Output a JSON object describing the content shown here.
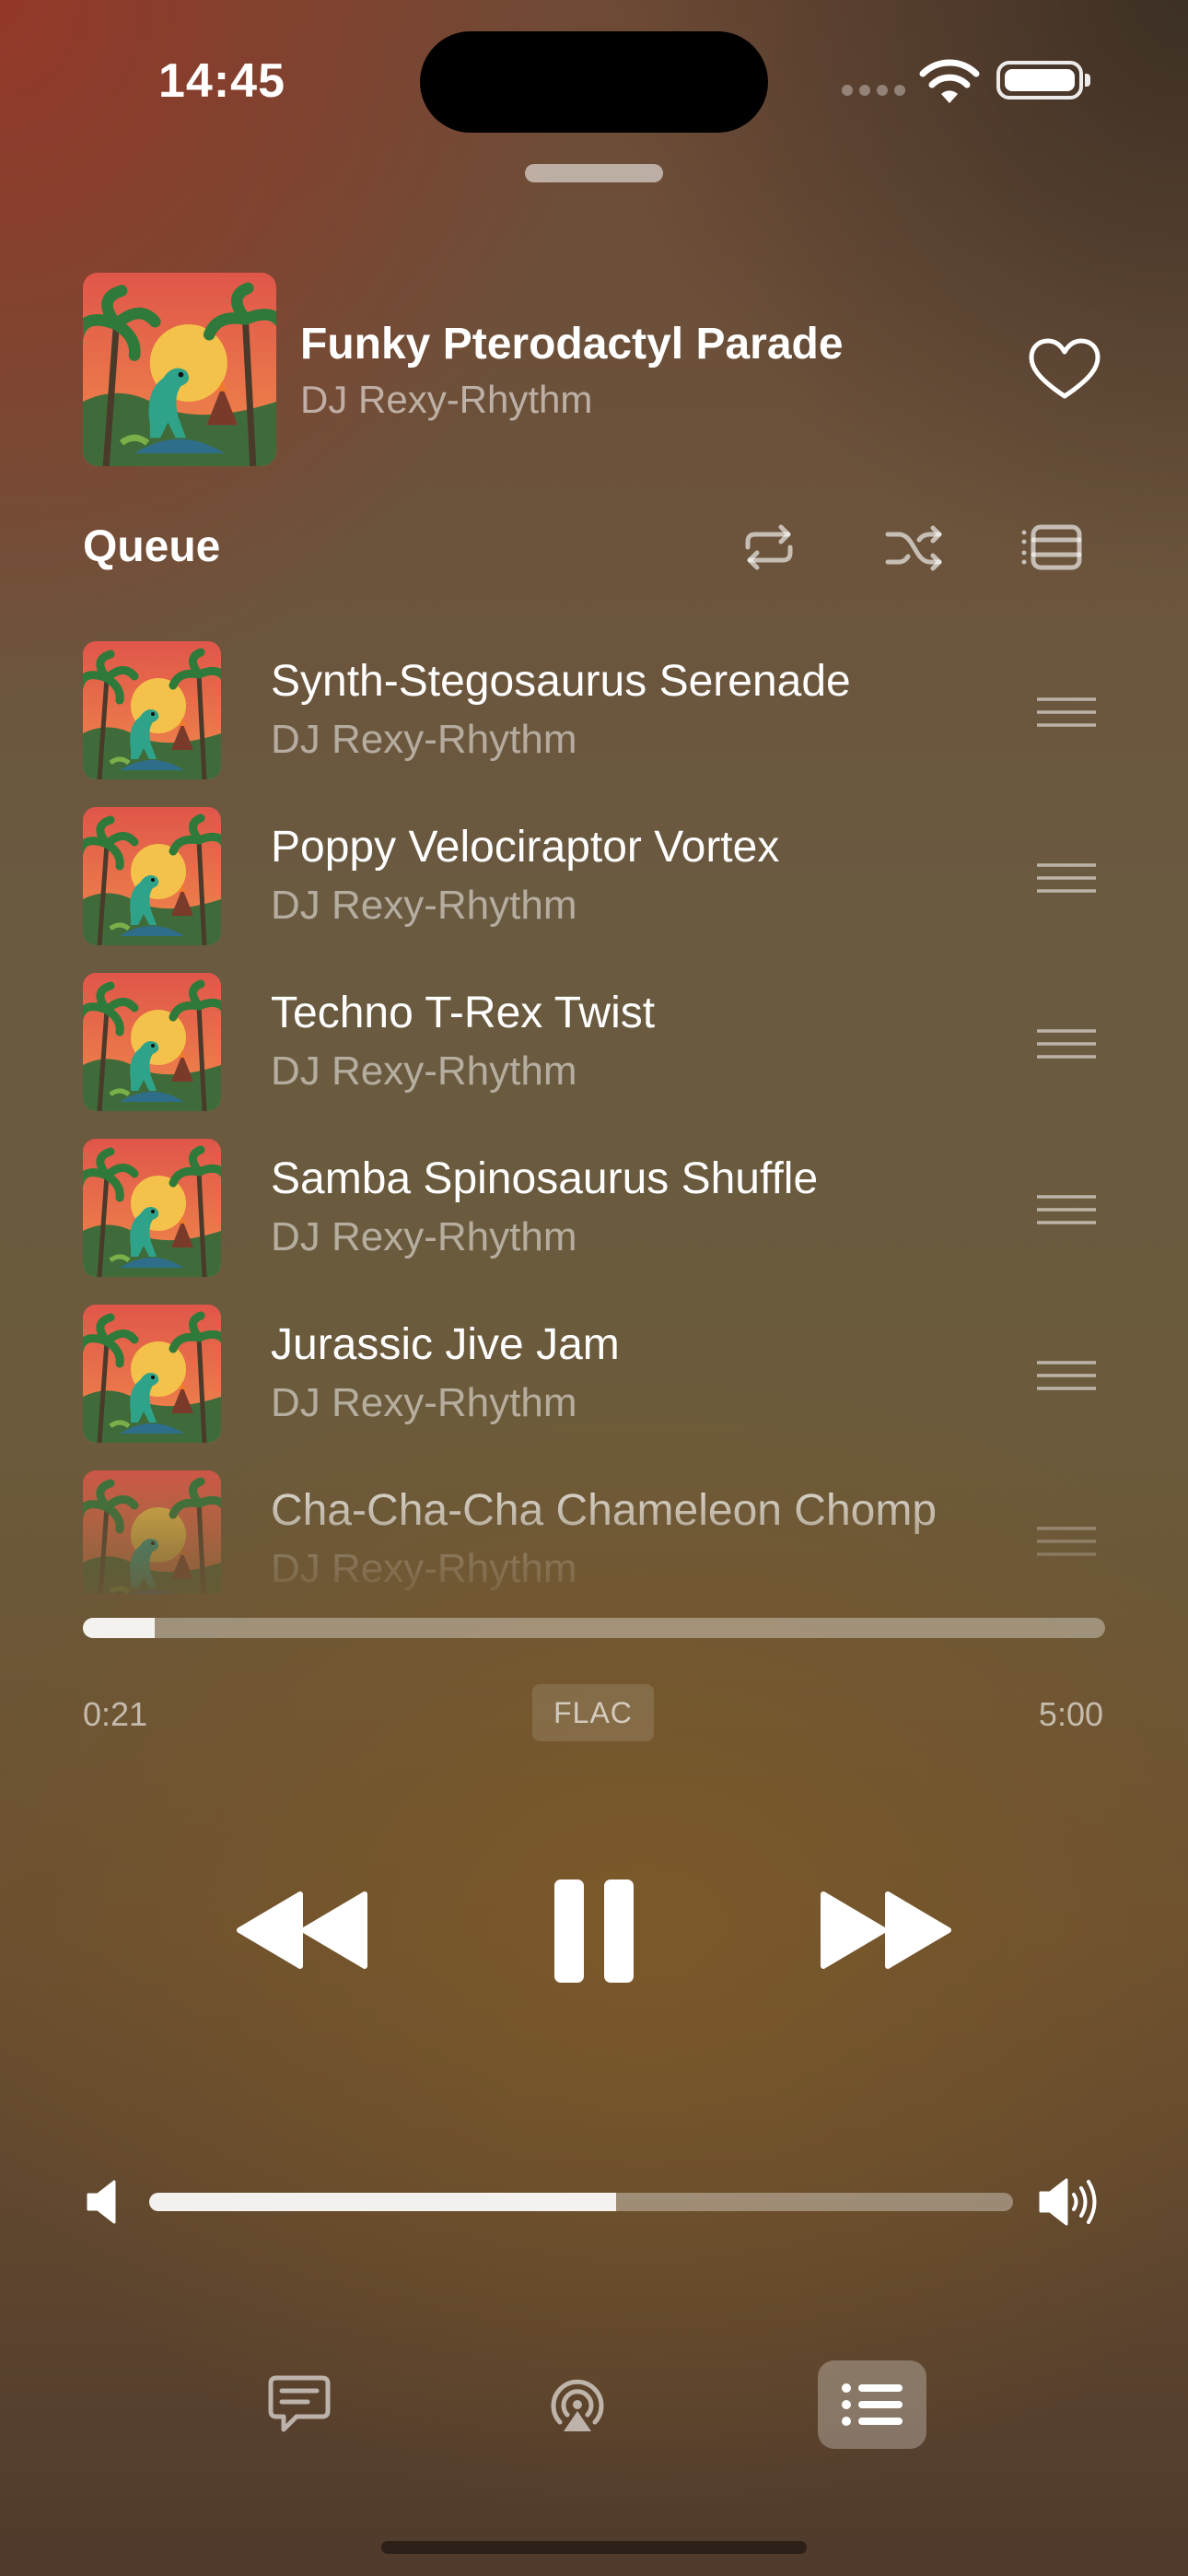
{
  "status_bar": {
    "time": "14:45"
  },
  "now_playing": {
    "title": "Funky Pterodactyl Parade",
    "artist": "DJ Rexy-Rhythm",
    "favorite": false
  },
  "queue": {
    "label": "Queue",
    "items": [
      {
        "title": "Synth-Stegosaurus Serenade",
        "artist": "DJ Rexy-Rhythm"
      },
      {
        "title": "Poppy Velociraptor Vortex",
        "artist": "DJ Rexy-Rhythm"
      },
      {
        "title": "Techno T-Rex Twist",
        "artist": "DJ Rexy-Rhythm"
      },
      {
        "title": "Samba Spinosaurus Shuffle",
        "artist": "DJ Rexy-Rhythm"
      },
      {
        "title": "Jurassic Jive Jam",
        "artist": "DJ Rexy-Rhythm"
      },
      {
        "title": "Cha-Cha-Cha Chameleon Chomp",
        "artist": "DJ Rexy-Rhythm"
      }
    ]
  },
  "playback": {
    "elapsed": "0:21",
    "total": "5:00",
    "format": "FLAC",
    "progress_fraction": 0.07,
    "state": "playing"
  },
  "volume": {
    "level_fraction": 0.54
  },
  "icons": {
    "repeat": "repeat-icon",
    "shuffle": "shuffle-icon",
    "autoplay": "infinity-queue-icon",
    "lyrics": "lyrics-bubble-icon",
    "airplay": "airplay-icon",
    "queue": "list-icon"
  },
  "colors": {
    "accent": "#ffffff"
  }
}
